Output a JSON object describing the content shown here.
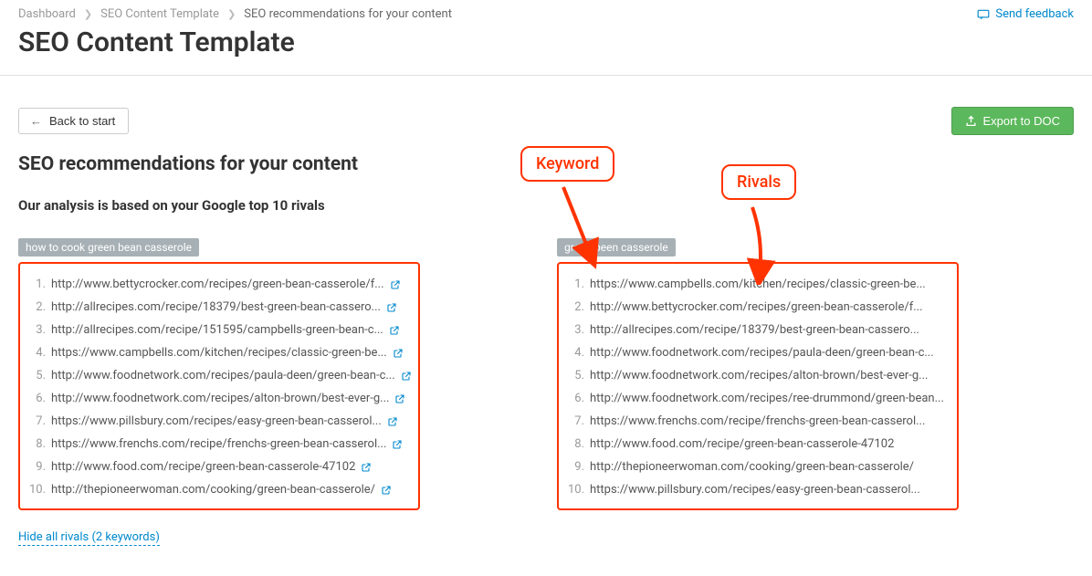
{
  "breadcrumb": {
    "item1": "Dashboard",
    "item2": "SEO Content Template",
    "item3": "SEO recommendations for your content"
  },
  "feedback": {
    "label": "Send feedback"
  },
  "page_title": "SEO Content Template",
  "back_button": "Back to start",
  "export_button": "Export to DOC",
  "subheading": "SEO recommendations for your content",
  "analysis_heading": "Our analysis is based on your Google top 10 rivals",
  "callout_keyword": "Keyword",
  "callout_rivals": "Rivals",
  "hide_link": "Hide all rivals (2 keywords)",
  "col1": {
    "tag": "how to cook green bean casserole",
    "items": [
      "http://www.bettycrocker.com/recipes/green-bean-casserole/f...",
      "http://allrecipes.com/recipe/18379/best-green-bean-cassero...",
      "http://allrecipes.com/recipe/151595/campbells-green-bean-c...",
      "https://www.campbells.com/kitchen/recipes/classic-green-be...",
      "http://www.foodnetwork.com/recipes/paula-deen/green-bean-c...",
      "http://www.foodnetwork.com/recipes/alton-brown/best-ever-g...",
      "https://www.pillsbury.com/recipes/easy-green-bean-casserol...",
      "https://www.frenchs.com/recipe/frenchs-green-bean-casserol...",
      "http://www.food.com/recipe/green-bean-casserole-47102",
      "http://thepioneerwoman.com/cooking/green-bean-casserole/"
    ]
  },
  "col2": {
    "tag": "green been casserole",
    "items": [
      "https://www.campbells.com/kitchen/recipes/classic-green-be...",
      "http://www.bettycrocker.com/recipes/green-bean-casserole/f...",
      "http://allrecipes.com/recipe/18379/best-green-bean-cassero...",
      "http://www.foodnetwork.com/recipes/paula-deen/green-bean-c...",
      "http://www.foodnetwork.com/recipes/alton-brown/best-ever-g...",
      "http://www.foodnetwork.com/recipes/ree-drummond/green-bean...",
      "https://www.frenchs.com/recipe/frenchs-green-bean-casserol...",
      "http://www.food.com/recipe/green-bean-casserole-47102",
      "http://thepioneerwoman.com/cooking/green-bean-casserole/",
      "https://www.pillsbury.com/recipes/easy-green-bean-casserol..."
    ]
  }
}
